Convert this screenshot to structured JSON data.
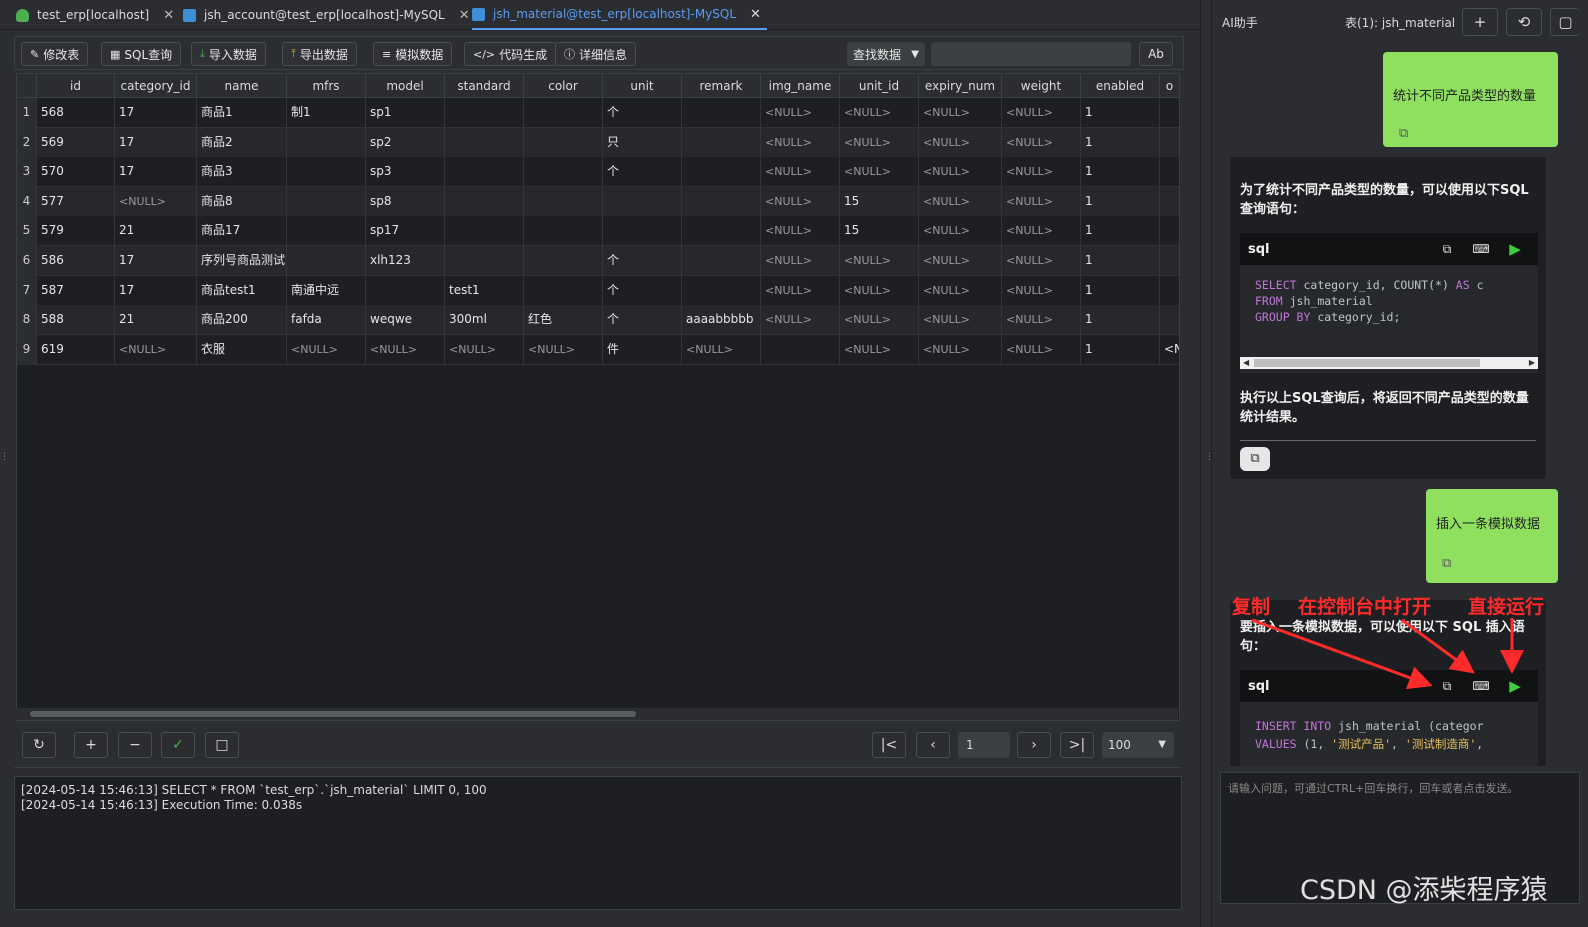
{
  "tabs": [
    {
      "label": "test_erp[localhost]",
      "close": "✕"
    },
    {
      "label": "jsh_account@test_erp[localhost]-MySQL",
      "close": "✕"
    },
    {
      "label": "jsh_material@test_erp[localhost]-MySQL",
      "close": "✕"
    }
  ],
  "toolbar": {
    "edit_table": "修改表",
    "sql_query": "SQL查询",
    "import_data": "导入数据",
    "export_data": "导出数据",
    "mock_data": "模拟数据",
    "code_gen": "代码生成",
    "detail_info": "详细信息",
    "find_select": "查找数据",
    "find_input": "",
    "ab": "Ab"
  },
  "grid": {
    "columns": [
      "id",
      "category_id",
      "name",
      "mfrs",
      "model",
      "standard",
      "color",
      "unit",
      "remark",
      "img_name",
      "unit_id",
      "expiry_num",
      "weight",
      "enabled",
      "o"
    ],
    "rows": [
      {
        "n": "1",
        "c": [
          "568",
          "17",
          "商品1",
          "制1",
          "sp1",
          "",
          "",
          "个",
          "",
          "<NULL>",
          "<NULL>",
          "<NULL>",
          "<NULL>",
          "1",
          ""
        ]
      },
      {
        "n": "2",
        "c": [
          "569",
          "17",
          "商品2",
          "",
          "sp2",
          "",
          "",
          "只",
          "",
          "<NULL>",
          "<NULL>",
          "<NULL>",
          "<NULL>",
          "1",
          ""
        ]
      },
      {
        "n": "3",
        "c": [
          "570",
          "17",
          "商品3",
          "",
          "sp3",
          "",
          "",
          "个",
          "",
          "<NULL>",
          "<NULL>",
          "<NULL>",
          "<NULL>",
          "1",
          ""
        ]
      },
      {
        "n": "4",
        "c": [
          "577",
          "<NULL>",
          "商品8",
          "",
          "sp8",
          "",
          "",
          "",
          "",
          "<NULL>",
          "15",
          "<NULL>",
          "<NULL>",
          "1",
          ""
        ]
      },
      {
        "n": "5",
        "c": [
          "579",
          "21",
          "商品17",
          "",
          "sp17",
          "",
          "",
          "",
          "",
          "<NULL>",
          "15",
          "<NULL>",
          "<NULL>",
          "1",
          ""
        ]
      },
      {
        "n": "6",
        "c": [
          "586",
          "17",
          "序列号商品测试",
          "",
          "xlh123",
          "",
          "",
          "个",
          "",
          "<NULL>",
          "<NULL>",
          "<NULL>",
          "<NULL>",
          "1",
          ""
        ]
      },
      {
        "n": "7",
        "c": [
          "587",
          "17",
          "商品test1",
          "南通中远",
          "",
          "test1",
          "",
          "个",
          "",
          "<NULL>",
          "<NULL>",
          "<NULL>",
          "<NULL>",
          "1",
          ""
        ]
      },
      {
        "n": "8",
        "c": [
          "588",
          "21",
          "商品200",
          "fafda",
          "weqwe",
          "300ml",
          "红色",
          "个",
          "aaaabbbbb",
          "<NULL>",
          "<NULL>",
          "<NULL>",
          "<NULL>",
          "1",
          ""
        ]
      },
      {
        "n": "9",
        "c": [
          "619",
          "<NULL>",
          "衣服",
          "<NULL>",
          "<NULL>",
          "<NULL>",
          "<NULL>",
          "件",
          "<NULL>",
          "",
          "<NULL>",
          "<NULL>",
          "<NULL>",
          "1",
          "<N"
        ]
      }
    ]
  },
  "pager": {
    "page": "1",
    "page_size": "100"
  },
  "console": {
    "lines": [
      "[2024-05-14 15:46:13] SELECT * FROM `test_erp`.`jsh_material`  LIMIT 0, 100",
      "[2024-05-14 15:46:13] Execution Time: 0.038s"
    ]
  },
  "ai": {
    "title": "AI助手",
    "table_label": "表(1): jsh_material",
    "msg1_user": "统计不同产品类型的数量",
    "msg1_ai_intro": "为了统计不同产品类型的数量，可以使用以下SQL 查询语句：",
    "code_lang": "sql",
    "code1": {
      "l1a": "SELECT",
      "l1b": " category_id, COUNT(*) ",
      "l1c": "AS",
      "l1d": " c",
      "l2a": "FROM",
      "l2b": " jsh_material",
      "l3a": "GROUP BY",
      "l3b": " category_id;"
    },
    "msg1_ai_outro": "执行以上SQL查询后，将返回不同产品类型的数量统计结果。",
    "msg2_user": "插入一条模拟数据",
    "msg2_ai_intro": "要插入一条模拟数据，可以使用以下 SQL 插入语句：",
    "code2": {
      "l1a": "INSERT INTO",
      "l1b": " jsh_material (categor",
      "l2a": "VALUES",
      "l2b": " (1, ",
      "l2c": "'测试产品'",
      "l2d": ", ",
      "l2e": "'测试制造商'",
      "l2f": ","
    },
    "prompt_placeholder": "请输入问题，可通过CTRL+回车换行，回车或者点击发送。"
  },
  "annotations": {
    "copy": "复制",
    "open_console": "在控制台中打开",
    "run_direct": "直接运行"
  },
  "watermark": "CSDN @添柴程序猿",
  "colors": {
    "accent": "#5a9cf5",
    "user_bubble": "#90e060",
    "annotation": "#ff2a2a",
    "run_green": "#3ccf3c"
  }
}
